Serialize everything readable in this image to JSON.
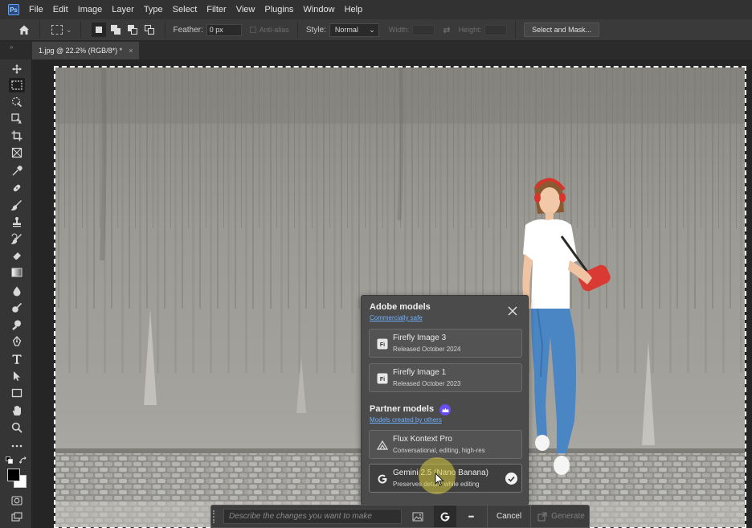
{
  "app": {
    "logo_text": "Ps"
  },
  "menu": [
    "File",
    "Edit",
    "Image",
    "Layer",
    "Type",
    "Select",
    "Filter",
    "View",
    "Plugins",
    "Window",
    "Help"
  ],
  "options": {
    "feather_label": "Feather:",
    "feather_value": "0 px",
    "antialias_label": "Anti-alias",
    "style_label": "Style:",
    "style_value": "Normal",
    "width_label": "Width:",
    "height_label": "Height:",
    "select_mask_label": "Select and Mask..."
  },
  "document": {
    "tab_title": "1.jpg @ 22.2% (RGB/8*) *",
    "close_glyph": "×"
  },
  "model_picker": {
    "adobe_heading": "Adobe models",
    "adobe_sub": "Commercially safe",
    "partner_heading": "Partner models",
    "partner_sub": "Models created by others",
    "models": [
      {
        "name": "Firefly Image 3",
        "desc": "Released October 2024",
        "icon": "firefly-icon",
        "selected": false
      },
      {
        "name": "Firefly Image 1",
        "desc": "Released October 2023",
        "icon": "firefly-icon",
        "selected": false
      },
      {
        "name": "Flux Kontext Pro",
        "desc": "Conversational, editing, high-res",
        "icon": "flux-icon",
        "selected": false
      },
      {
        "name": "Gemini 2.5 (Nano Banana)",
        "desc": "Preserves details while editing",
        "icon": "google-g-icon",
        "selected": true
      }
    ],
    "firefly_badge": "Fi"
  },
  "taskbar": {
    "prompt_placeholder": "Describe the changes you want to make",
    "model_badge": "G",
    "more_glyph": "•••",
    "cancel_label": "Cancel",
    "generate_label": "Generate"
  },
  "colors": {
    "accent_link": "#6fb0ff",
    "crown_badge": "#6a4cf0",
    "foreground": "#000000",
    "background": "#ffffff"
  }
}
